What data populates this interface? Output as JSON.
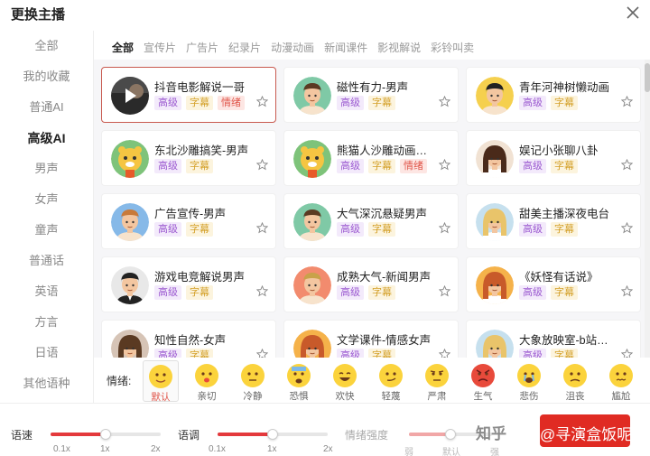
{
  "dialog": {
    "title": "更换主播"
  },
  "sidebar": {
    "items": [
      {
        "label": "全部",
        "active": false
      },
      {
        "label": "我的收藏",
        "active": false
      },
      {
        "label": "普通AI",
        "active": false
      },
      {
        "label": "高级AI",
        "active": true
      },
      {
        "label": "男声",
        "active": false
      },
      {
        "label": "女声",
        "active": false
      },
      {
        "label": "童声",
        "active": false
      },
      {
        "label": "普通话",
        "active": false
      },
      {
        "label": "英语",
        "active": false
      },
      {
        "label": "方言",
        "active": false
      },
      {
        "label": "日语",
        "active": false
      },
      {
        "label": "其他语种",
        "active": false
      }
    ]
  },
  "tabs": [
    {
      "label": "全部",
      "active": true
    },
    {
      "label": "宣传片",
      "active": false
    },
    {
      "label": "广告片",
      "active": false
    },
    {
      "label": "纪录片",
      "active": false
    },
    {
      "label": "动漫动画",
      "active": false
    },
    {
      "label": "新闻课件",
      "active": false
    },
    {
      "label": "影视解说",
      "active": false
    },
    {
      "label": "彩铃叫卖",
      "active": false
    }
  ],
  "voices": [
    {
      "name": "抖音电影解说一哥",
      "tags": [
        "高级",
        "字幕",
        "情绪"
      ],
      "avatar": "play",
      "selected": true
    },
    {
      "name": "磁性有力-男声",
      "tags": [
        "高级",
        "字幕"
      ],
      "avatar": "man-brown"
    },
    {
      "name": "青年河神树懒动画",
      "tags": [
        "高级",
        "字幕"
      ],
      "avatar": "man-yellow"
    },
    {
      "name": "东北沙雕搞笑-男声",
      "tags": [
        "高级",
        "字幕"
      ],
      "avatar": "tiger"
    },
    {
      "name": "熊猫人沙雕动画…",
      "tags": [
        "高级",
        "字幕",
        "情绪"
      ],
      "avatar": "tiger"
    },
    {
      "name": "娱记小张聊八卦",
      "tags": [
        "高级",
        "字幕"
      ],
      "avatar": "woman-curly"
    },
    {
      "name": "广告宣传-男声",
      "tags": [
        "高级",
        "字幕"
      ],
      "avatar": "man-blue"
    },
    {
      "name": "大气深沉悬疑男声",
      "tags": [
        "高级",
        "字幕"
      ],
      "avatar": "man-brown"
    },
    {
      "name": "甜美主播深夜电台",
      "tags": [
        "高级",
        "字幕"
      ],
      "avatar": "woman-blonde"
    },
    {
      "name": "游戏电竞解说男声",
      "tags": [
        "高级",
        "字幕"
      ],
      "avatar": "man-suit"
    },
    {
      "name": "成熟大气-新闻男声",
      "tags": [
        "高级",
        "字幕"
      ],
      "avatar": "man-pink"
    },
    {
      "name": "《妖怪有话说》",
      "tags": [
        "高级",
        "字幕"
      ],
      "avatar": "woman-orange"
    },
    {
      "name": "知性自然-女声",
      "tags": [
        "高级",
        "字幕"
      ],
      "avatar": "woman-brown"
    },
    {
      "name": "文学课件-情感女声",
      "tags": [
        "高级",
        "字幕"
      ],
      "avatar": "woman-orange"
    },
    {
      "name": "大象放映室-b站…",
      "tags": [
        "高级",
        "字幕"
      ],
      "avatar": "woman-blonde"
    }
  ],
  "emotion": {
    "label": "情绪:",
    "items": [
      {
        "label": "默认",
        "active": true,
        "face": "smile"
      },
      {
        "label": "亲切",
        "face": "kiss"
      },
      {
        "label": "冷静",
        "face": "neutral"
      },
      {
        "label": "恐惧",
        "face": "fear"
      },
      {
        "label": "欢快",
        "face": "laugh"
      },
      {
        "label": "轻蔑",
        "face": "smirk"
      },
      {
        "label": "严肃",
        "face": "serious"
      },
      {
        "label": "生气",
        "face": "angry"
      },
      {
        "label": "悲伤",
        "face": "cry"
      },
      {
        "label": "沮丧",
        "face": "down"
      },
      {
        "label": "尴尬",
        "face": "awkward"
      }
    ]
  },
  "controls": {
    "speed": {
      "label": "语速",
      "ticks": [
        "0.1x",
        "1x",
        "2x"
      ],
      "value": 0.5
    },
    "pitch": {
      "label": "语调",
      "ticks": [
        "0.1x",
        "1x",
        "2x"
      ],
      "value": 0.5
    },
    "intensity": {
      "label": "情绪强度",
      "ticks": [
        "弱",
        "默认",
        "强"
      ],
      "value": 0.5,
      "disabled": true
    }
  },
  "watermark": {
    "logo": "知乎",
    "text": "@寻演盒饭呢"
  },
  "colors": {
    "accent": "#e02b23",
    "selected_border": "#c85a50"
  }
}
